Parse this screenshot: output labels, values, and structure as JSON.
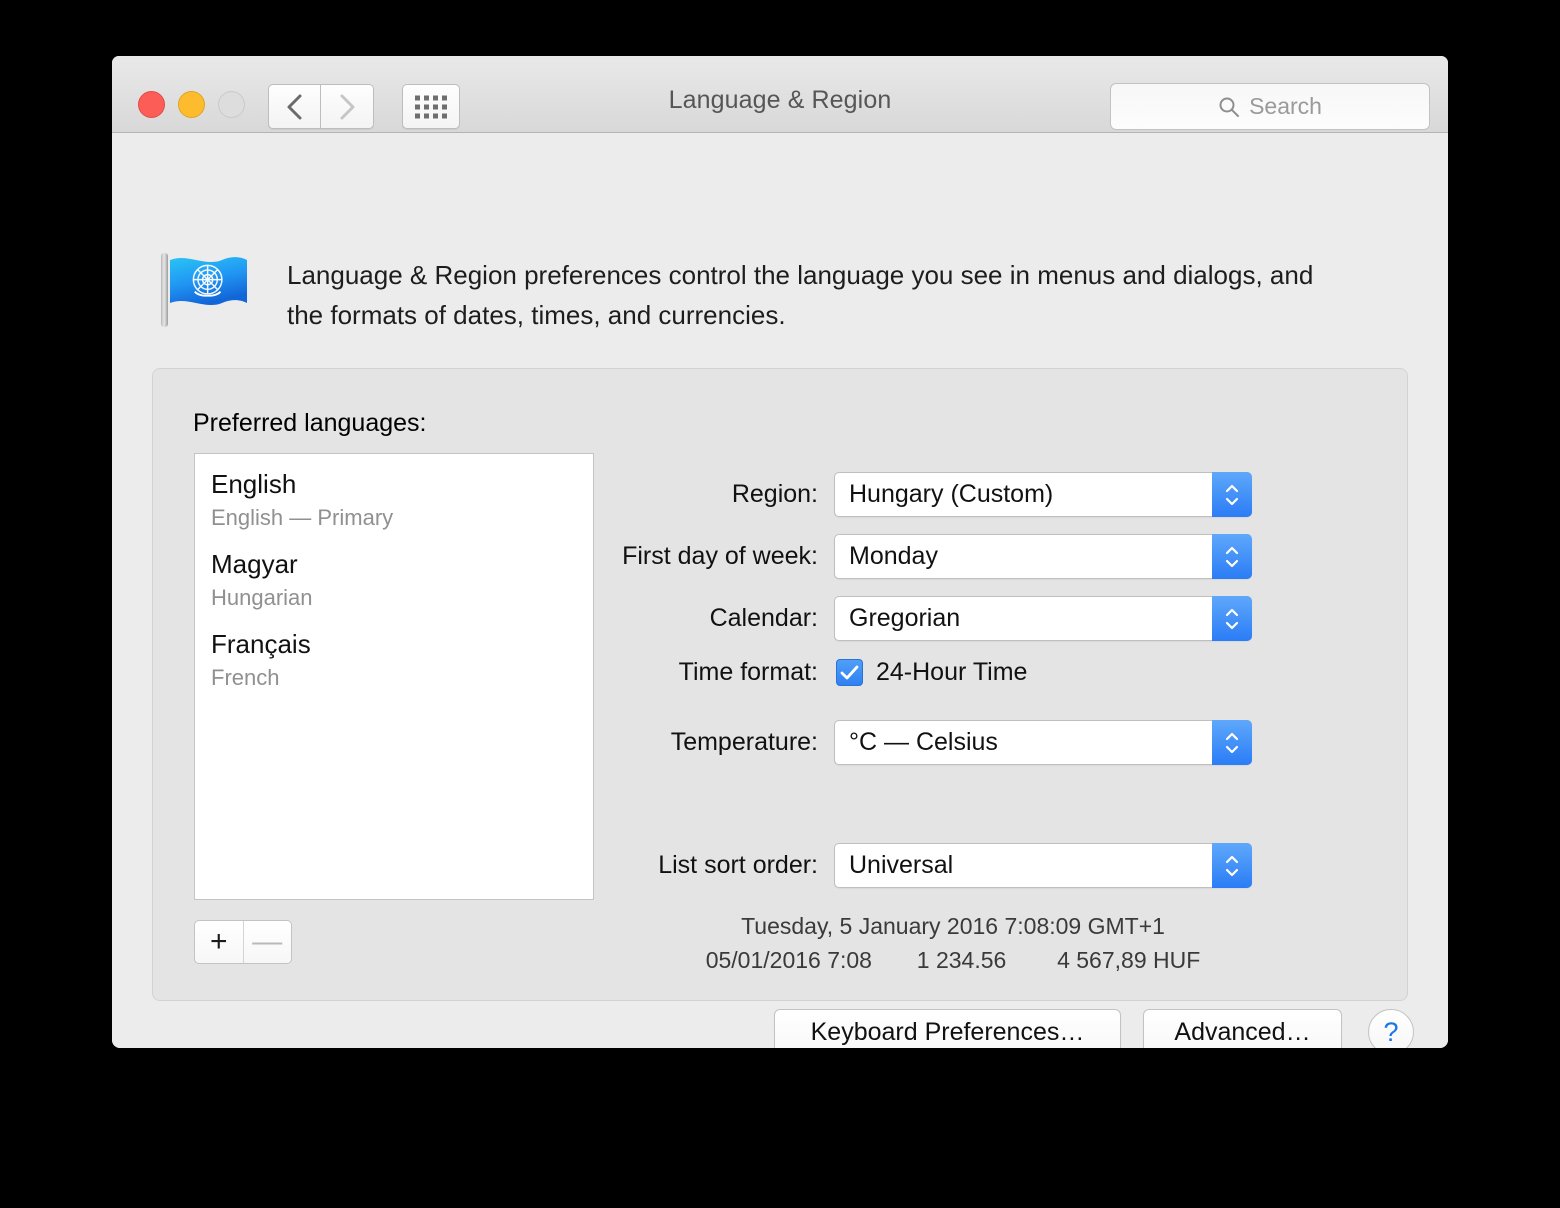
{
  "window": {
    "title": "Language & Region",
    "traffic_lights": {
      "close": "close-button",
      "minimize": "minimize-button",
      "zoom": "zoom-button"
    }
  },
  "toolbar": {
    "back_icon": "chevron-left-icon",
    "forward_icon": "chevron-right-icon",
    "show_all_icon": "grid-icon",
    "search": {
      "placeholder": "Search",
      "icon": "search-icon",
      "value": ""
    }
  },
  "intro": {
    "icon": "un-flag-icon",
    "text": "Language & Region preferences control the language you see in menus and dialogs, and the formats of dates, times, and currencies."
  },
  "preferred_languages": {
    "label": "Preferred languages:",
    "items": [
      {
        "name": "English",
        "sub": "English — Primary"
      },
      {
        "name": "Magyar",
        "sub": "Hungarian"
      },
      {
        "name": "Français",
        "sub": "French"
      }
    ],
    "add_label": "+",
    "remove_label": "—"
  },
  "settings": {
    "region": {
      "label": "Region:",
      "value": "Hungary (Custom)"
    },
    "first_day_of_week": {
      "label": "First day of week:",
      "value": "Monday"
    },
    "calendar": {
      "label": "Calendar:",
      "value": "Gregorian"
    },
    "time_format": {
      "label": "Time format:",
      "checkbox_label": "24-Hour Time",
      "checked": true
    },
    "temperature": {
      "label": "Temperature:",
      "value": "°C — Celsius"
    },
    "list_sort_order": {
      "label": "List sort order:",
      "value": "Universal"
    }
  },
  "preview": {
    "line1": "Tuesday, 5 January 2016 7:08:09 GMT+1",
    "date_short": "05/01/2016 7:08",
    "number": "1 234.56",
    "currency": "4 567,89 HUF"
  },
  "footer": {
    "keyboard_preferences": "Keyboard Preferences…",
    "advanced": "Advanced…",
    "help": "?"
  },
  "colors": {
    "accent_blue": "#2f80f2",
    "stepper_blue": "#2b7cf6",
    "help_blue": "#1a76e8",
    "close_red": "#fc5d57",
    "minimize_yellow": "#fdbc2e",
    "zoom_gray": "#dddddd",
    "window_bg": "#ececec",
    "groupbox_bg": "#e4e4e4"
  }
}
